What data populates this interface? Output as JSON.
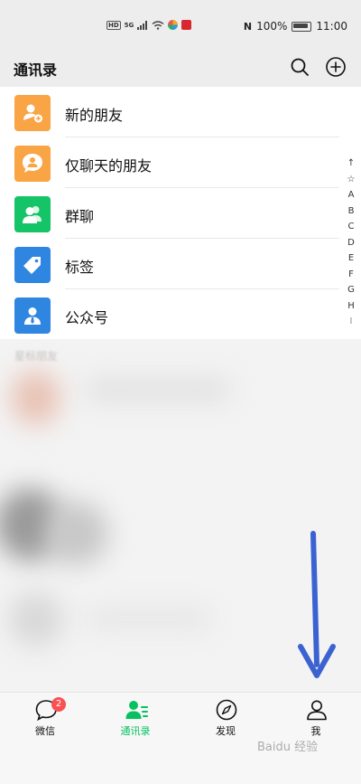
{
  "status_bar": {
    "hd": "HD",
    "signal": "5G",
    "battery": "100%",
    "time": "11:00"
  },
  "header": {
    "title": "通讯录"
  },
  "colors": {
    "accent": "#07c160",
    "orange": "#f9a445",
    "green": "#14c467",
    "blue": "#2f86e0",
    "badge": "#fa5151",
    "arrow": "#3b62d1"
  },
  "contact_list": {
    "items": [
      {
        "label": "新的朋友",
        "icon": "add-friend-icon"
      },
      {
        "label": "仅聊天的朋友",
        "icon": "chat-only-friend-icon"
      },
      {
        "label": "群聊",
        "icon": "group-chat-icon"
      },
      {
        "label": "标签",
        "icon": "tag-icon"
      },
      {
        "label": "公众号",
        "icon": "official-account-icon"
      }
    ]
  },
  "alpha_index": [
    "↑",
    "☆",
    "A",
    "B",
    "C",
    "D",
    "E",
    "F",
    "G",
    "H",
    "I"
  ],
  "section": {
    "starred_header": "星标朋友"
  },
  "bottom_nav": {
    "tabs": [
      {
        "label": "微信",
        "badge": "2"
      },
      {
        "label": "通讯录"
      },
      {
        "label": "发现"
      },
      {
        "label": "我"
      }
    ]
  },
  "watermark": "Baidu 经验"
}
